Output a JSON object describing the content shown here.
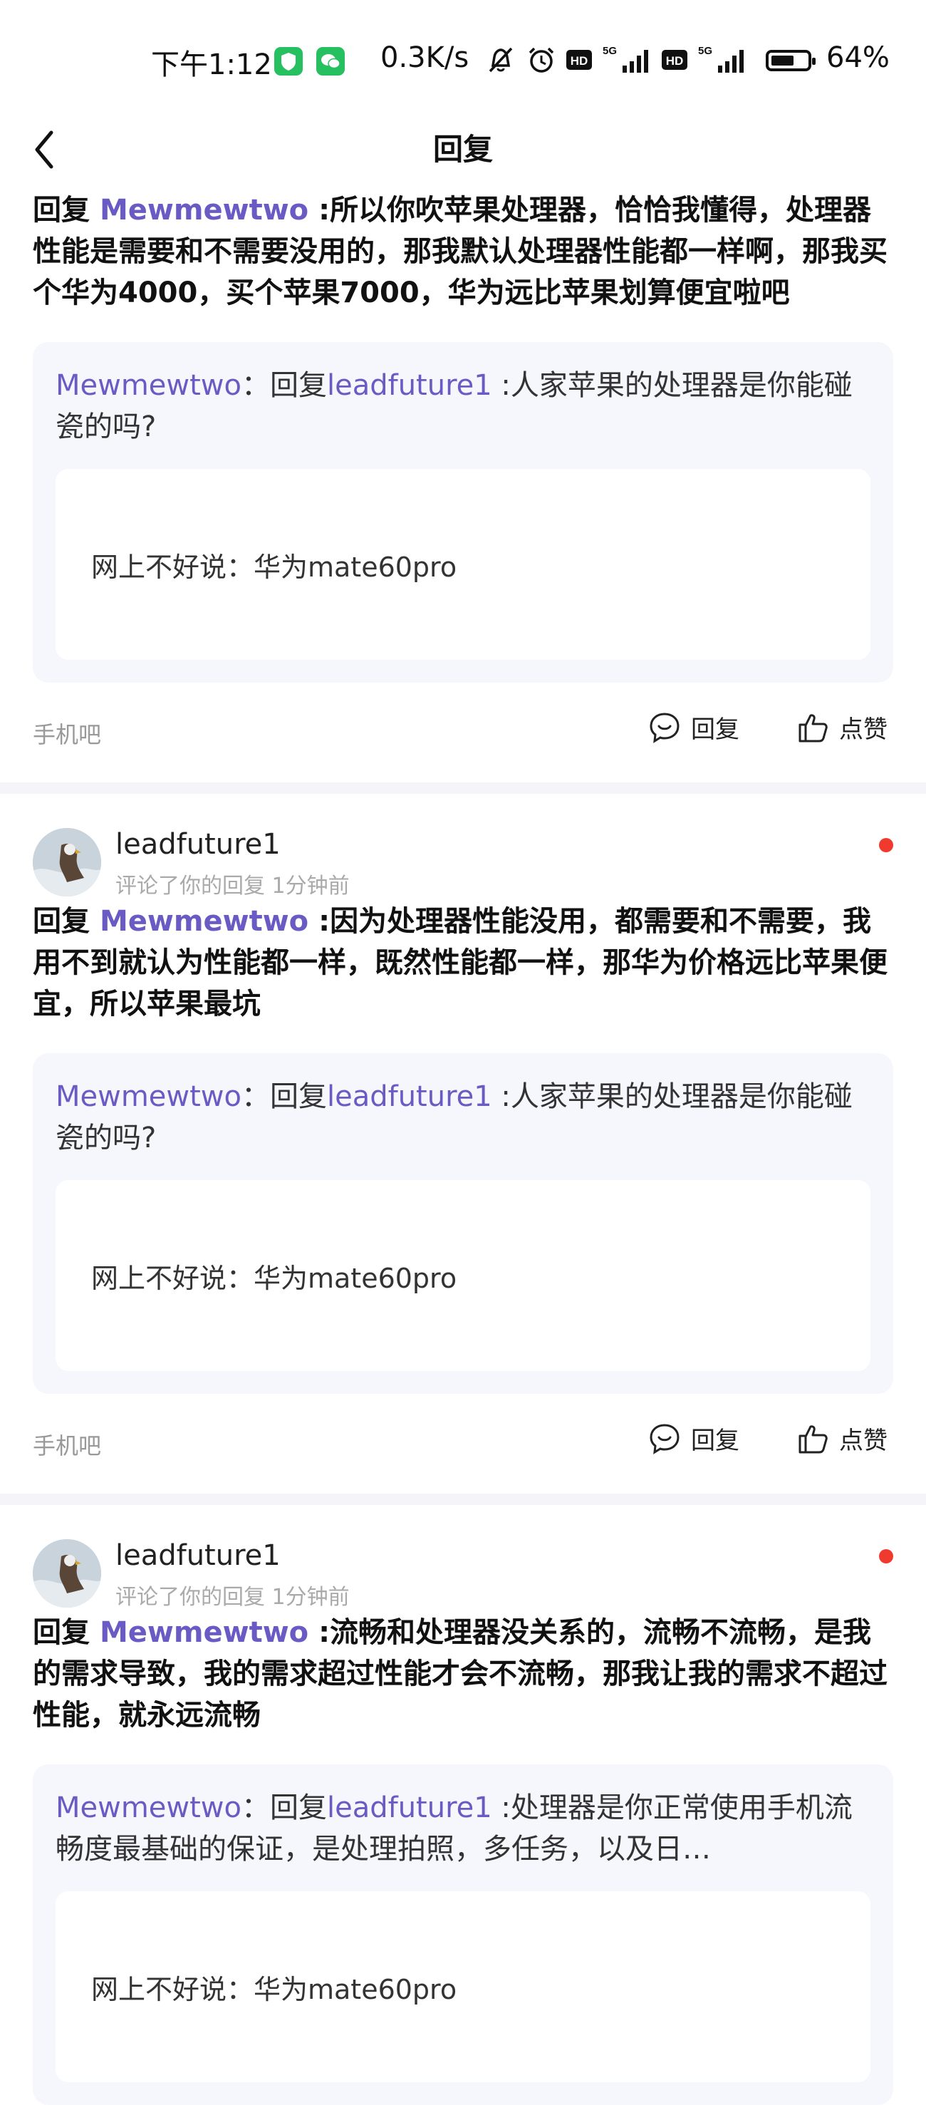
{
  "status": {
    "time": "下午1:12",
    "network_speed": "0.3K/s",
    "battery_pct": "64%",
    "battery_level": 0.64,
    "app_colors": [
      "#25c05a",
      "#25c05a"
    ]
  },
  "nav": {
    "title": "回复",
    "back_icon": "chevron-left-icon"
  },
  "items": [
    {
      "reply_prefix": "回复",
      "reply_to": "Mewmewtwo",
      "text": " :所以你吹苹果处理器，恰恰我懂得，处理器性能是需要和不需要没用的，那我默认处理器性能都一样啊，那我买个华为4000，买个苹果7000，华为远比苹果划算便宜啦吧",
      "quote": {
        "author": "Mewmewtwo",
        "sep": "：回复",
        "target": "leadfuture1",
        "text": " :人家苹果的处理器是你能碰瓷的吗?"
      },
      "post_title": "网上不好说：华为mate60pro",
      "forum": "手机吧",
      "reply_label": "回复",
      "like_label": "点赞"
    },
    {
      "username": "leadfuture1",
      "meta": "评论了你的回复  1分钟前",
      "reply_prefix": "回复",
      "reply_to": "Mewmewtwo",
      "text": " :因为处理器性能没用，都需要和不需要，我用不到就认为性能都一样，既然性能都一样，那华为价格远比苹果便宜，所以苹果最坑",
      "quote": {
        "author": "Mewmewtwo",
        "sep": "：回复",
        "target": "leadfuture1",
        "text": " :人家苹果的处理器是你能碰瓷的吗?"
      },
      "post_title": "网上不好说：华为mate60pro",
      "forum": "手机吧",
      "reply_label": "回复",
      "like_label": "点赞"
    },
    {
      "username": "leadfuture1",
      "meta": "评论了你的回复  1分钟前",
      "reply_prefix": "回复",
      "reply_to": "Mewmewtwo",
      "text": " :流畅和处理器没关系的，流畅不流畅，是我的需求导致，我的需求超过性能才会不流畅，那我让我的需求不超过性能，就永远流畅",
      "quote": {
        "author": "Mewmewtwo",
        "sep": "：回复",
        "target": "leadfuture1",
        "text": " :处理器是你正常使用手机流畅度最基础的保证，是处理拍照，多任务，以及日…"
      },
      "post_title": "网上不好说：华为mate60pro"
    }
  ]
}
